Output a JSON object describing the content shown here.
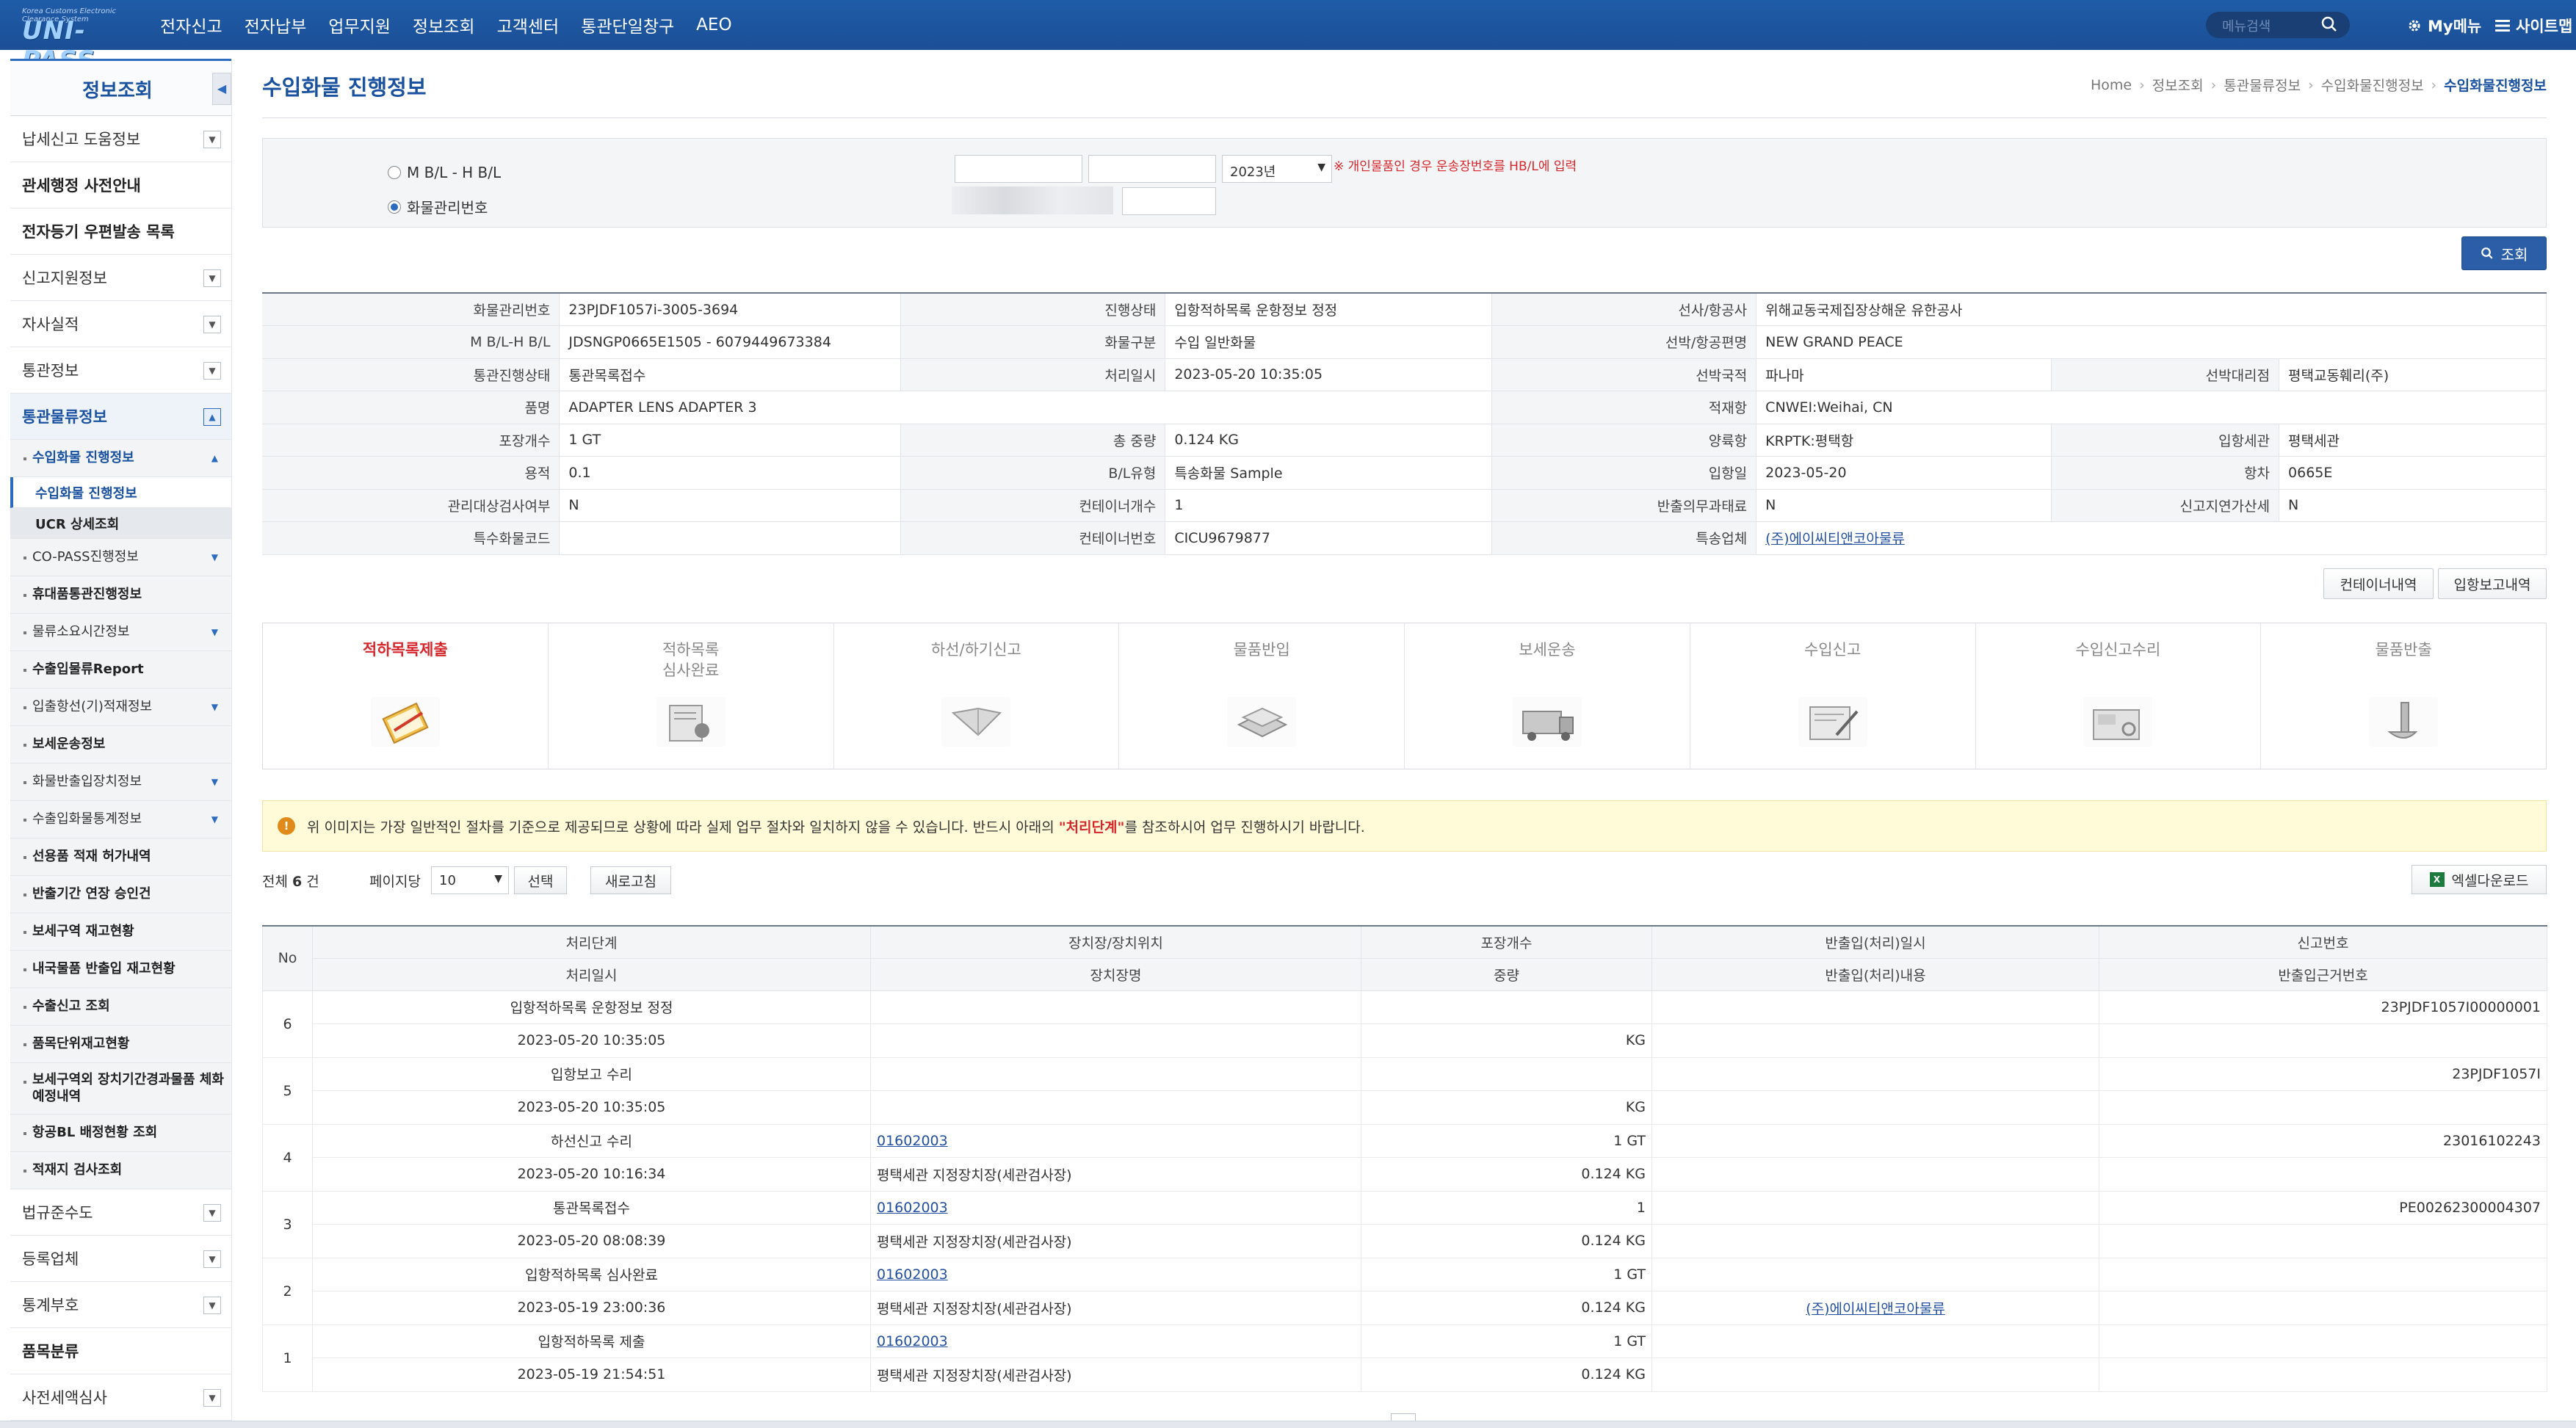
{
  "header": {
    "logo_sub": "Korea Customs Electronic Clearance System",
    "logo_main": "UNI-PASS",
    "nav": [
      "전자신고",
      "전자납부",
      "업무지원",
      "정보조회",
      "고객센터",
      "통관단일창구",
      "AEO"
    ],
    "search_placeholder": "메뉴검색",
    "my_menu": "My메뉴",
    "sitemap": "사이트맵"
  },
  "sidebar": {
    "title": "정보조회",
    "items": [
      {
        "label": "납세신고 도움정보",
        "type": "item",
        "chev": true
      },
      {
        "label": "관세행정 사전안내",
        "type": "item",
        "bold": true
      },
      {
        "label": "전자등기 우편발송 목록",
        "type": "item",
        "bold": true
      },
      {
        "label": "신고지원정보",
        "type": "item",
        "chev": true
      },
      {
        "label": "자사실적",
        "type": "item",
        "chev": true
      },
      {
        "label": "통관정보",
        "type": "item",
        "chev": true
      },
      {
        "label": "통관물류정보",
        "type": "item",
        "chev": true,
        "active": true
      },
      {
        "label": "수입화물 진행정보",
        "type": "sub",
        "blue": true,
        "dd": "up"
      },
      {
        "label": "수입화물 진행정보",
        "type": "sub2",
        "cur": true
      },
      {
        "label": "UCR 상세조회",
        "type": "sub2",
        "gray": true
      },
      {
        "label": "CO-PASS진행정보",
        "type": "sub",
        "dd": "down"
      },
      {
        "label": "휴대품통관진행정보",
        "type": "sub",
        "bold": true
      },
      {
        "label": "물류소요시간정보",
        "type": "sub",
        "dd": "down"
      },
      {
        "label": "수출입물류Report",
        "type": "sub",
        "bold": true
      },
      {
        "label": "입출항선(기)적재정보",
        "type": "sub",
        "dd": "down"
      },
      {
        "label": "보세운송정보",
        "type": "sub",
        "bold": true
      },
      {
        "label": "화물반출입장치정보",
        "type": "sub",
        "dd": "down"
      },
      {
        "label": "수출입화물통계정보",
        "type": "sub",
        "dd": "down"
      },
      {
        "label": "선용품 적재 허가내역",
        "type": "sub",
        "bold": true
      },
      {
        "label": "반출기간 연장 승인건",
        "type": "sub",
        "bold": true
      },
      {
        "label": "보세구역 재고현황",
        "type": "sub",
        "bold": true
      },
      {
        "label": "내국물품 반출입 재고현황",
        "type": "sub",
        "bold": true
      },
      {
        "label": "수출신고 조회",
        "type": "sub",
        "bold": true
      },
      {
        "label": "품목단위재고현황",
        "type": "sub",
        "bold": true
      },
      {
        "label": "보세구역외 장치기간경과물품 체화 예정내역",
        "type": "sub",
        "bold": true,
        "tall": true
      },
      {
        "label": "항공BL 배정현황 조회",
        "type": "sub",
        "bold": true
      },
      {
        "label": "적재지 검사조회",
        "type": "sub",
        "bold": true
      },
      {
        "label": "법규준수도",
        "type": "item",
        "chev": true
      },
      {
        "label": "등록업체",
        "type": "item",
        "chev": true
      },
      {
        "label": "통계부호",
        "type": "item",
        "chev": true
      },
      {
        "label": "품목분류",
        "type": "item",
        "bold": true
      },
      {
        "label": "사전세액심사",
        "type": "item",
        "chev": true
      }
    ]
  },
  "page": {
    "title": "수입화물 진행정보",
    "breadcrumb": [
      "Home",
      "정보조회",
      "통관물류정보",
      "수입화물진행정보",
      "수입화물진행정보"
    ]
  },
  "search": {
    "radio1": "M B/L - H B/L",
    "radio2": "화물관리번호",
    "year": "2023년",
    "hint": "※ 개인물품인 경우 운송장번호를 HB/L에 입력",
    "button": "조회"
  },
  "info": {
    "rows": [
      [
        {
          "k": "화물관리번호",
          "v": "23PJDF1057i-3005-3694"
        },
        {
          "k": "진행상태",
          "v": "입항적하목록 운항정보 정정"
        },
        {
          "k": "선사/항공사",
          "v": "위해교동국제집장상해운 유한공사",
          "span": true
        }
      ],
      [
        {
          "k": "M B/L-H B/L",
          "v": "JDSNGP0665E1505 - 6079449673384"
        },
        {
          "k": "화물구분",
          "v": "수입 일반화물"
        },
        {
          "k": "선박/항공편명",
          "v": "NEW GRAND PEACE",
          "span": true
        }
      ],
      [
        {
          "k": "통관진행상태",
          "v": "통관목록접수"
        },
        {
          "k": "처리일시",
          "v": "2023-05-20 10:35:05"
        },
        {
          "k": "선박국적",
          "v": "파나마"
        },
        {
          "k": "선박대리점",
          "v": "평택교동훼리(주)"
        }
      ],
      [
        {
          "k": "품명",
          "v": "ADAPTER LENS ADAPTER 3",
          "span3": true
        },
        {
          "k": "적재항",
          "v": "CNWEI:Weihai, CN",
          "span": true
        }
      ],
      [
        {
          "k": "포장개수",
          "v": "1 GT"
        },
        {
          "k": "총 중량",
          "v": "0.124 KG"
        },
        {
          "k": "양륙항",
          "v": "KRPTK:평택항"
        },
        {
          "k": "입항세관",
          "v": "평택세관"
        }
      ],
      [
        {
          "k": "용적",
          "v": "0.1"
        },
        {
          "k": "B/L유형",
          "v": "특송화물 Sample"
        },
        {
          "k": "입항일",
          "v": "2023-05-20"
        },
        {
          "k": "항차",
          "v": "0665E"
        }
      ],
      [
        {
          "k": "관리대상검사여부",
          "v": "N"
        },
        {
          "k": "컨테이너개수",
          "v": "1"
        },
        {
          "k": "반출의무과태료",
          "v": "N"
        },
        {
          "k": "신고지연가산세",
          "v": "N"
        }
      ],
      [
        {
          "k": "특수화물코드",
          "v": ""
        },
        {
          "k": "컨테이너번호",
          "v": "CICU9679877"
        },
        {
          "k": "특송업체",
          "v": "(주)에이씨티앤코아물류",
          "link": true,
          "span": true
        }
      ]
    ],
    "btn_container": "컨테이너내역",
    "btn_arrival": "입항보고내역"
  },
  "process": {
    "steps": [
      "적하목록제출",
      "적하목록\n심사완료",
      "하선/하기신고",
      "물품반입",
      "보세운송",
      "수입신고",
      "수입신고수리",
      "물품반출"
    ],
    "current": 0
  },
  "notice": {
    "pre": "위 이미지는 가장 일반적인 절차를 기준으로 제공되므로 상황에 따라 실제 업무 절차와 일치하지 않을 수 있습니다. 반드시 아래의 ",
    "emph": "\"처리단계\"",
    "post": "를 참조하시어 업무 진행하시기 바랍니다."
  },
  "list_controls": {
    "total_label": "전체",
    "total_count": "6",
    "total_unit": "건",
    "perpage_label": "페이지당",
    "perpage_value": "10",
    "select_btn": "선택",
    "refresh_btn": "새로고침",
    "excel_btn": "엑셀다운로드"
  },
  "list": {
    "head1": [
      "No",
      "처리단계",
      "장치장/장치위치",
      "포장개수",
      "반출입(처리)일시",
      "신고번호"
    ],
    "head2": [
      "처리일시",
      "장치장명",
      "중량",
      "반출입(처리)내용",
      "반출입근거번호"
    ],
    "rows": [
      {
        "no": "6",
        "r1": [
          "입항적하목록 운항정보 정정",
          "",
          "",
          "",
          "23PJDF1057I00000001"
        ],
        "r2": [
          "2023-05-20 10:35:05",
          "",
          "KG",
          "",
          ""
        ]
      },
      {
        "no": "5",
        "r1": [
          "입항보고 수리",
          "",
          "",
          "",
          "23PJDF1057I"
        ],
        "r2": [
          "2023-05-20 10:35:05",
          "",
          "KG",
          "",
          ""
        ]
      },
      {
        "no": "4",
        "r1": [
          "하선신고 수리",
          "01602003",
          "1 GT",
          "",
          "23016102243"
        ],
        "r2": [
          "2023-05-20 10:16:34",
          "평택세관 지정장치장(세관검사장)",
          "0.124 KG",
          "",
          ""
        ]
      },
      {
        "no": "3",
        "r1": [
          "통관목록접수",
          "01602003",
          "1",
          "",
          "PE00262300004307"
        ],
        "r2": [
          "2023-05-20 08:08:39",
          "평택세관 지정장치장(세관검사장)",
          "0.124 KG",
          "",
          ""
        ]
      },
      {
        "no": "2",
        "r1": [
          "입항적하목록 심사완료",
          "01602003",
          "1 GT",
          "",
          ""
        ],
        "r2": [
          "2023-05-19 23:00:36",
          "평택세관 지정장치장(세관검사장)",
          "0.124 KG",
          "(주)에이씨티앤코아물류",
          ""
        ]
      },
      {
        "no": "1",
        "r1": [
          "입항적하목록 제출",
          "01602003",
          "1 GT",
          "",
          ""
        ],
        "r2": [
          "2023-05-19 21:54:51",
          "평택세관 지정장치장(세관검사장)",
          "0.124 KG",
          "",
          ""
        ]
      }
    ]
  }
}
